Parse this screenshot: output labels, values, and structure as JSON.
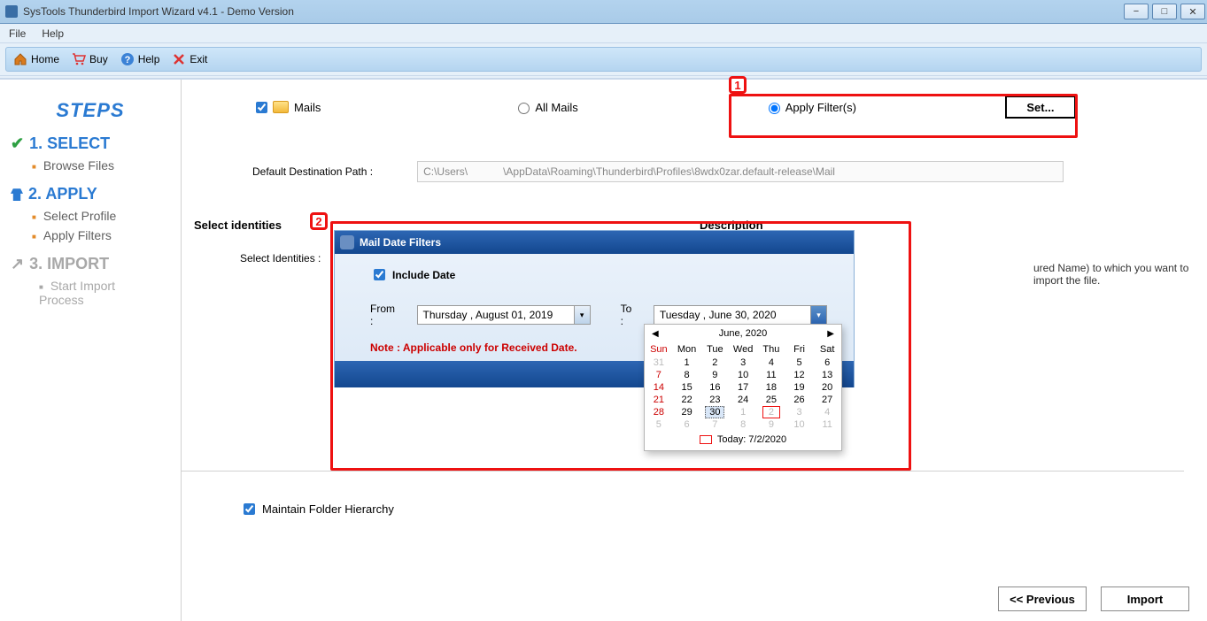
{
  "window": {
    "title": "SysTools Thunderbird Import Wizard v4.1 - Demo Version"
  },
  "menubar": {
    "file": "File",
    "help": "Help"
  },
  "toolbar": {
    "home": "Home",
    "buy": "Buy",
    "help": "Help",
    "exit": "Exit"
  },
  "sidebar": {
    "header": "STEPS",
    "step1": "1. SELECT",
    "s1a": "Browse Files",
    "step2": "2. APPLY",
    "s2a": "Select Profile",
    "s2b": "Apply Filters",
    "step3": "3. IMPORT",
    "s3a": "Start Import Process"
  },
  "content": {
    "mails_label": "Mails",
    "all_mails": "All Mails",
    "apply_filters": "Apply Filter(s)",
    "set_btn": "Set...",
    "dest_label": "Default Destination Path :",
    "dest_value": "C:\\Users\\            \\AppData\\Roaming\\Thunderbird\\Profiles\\8wdx0zar.default-release\\Mail",
    "select_identities_h": "Select identities",
    "description_h": "Description",
    "select_identities_l": "Select Identities :",
    "desc_tail": "ured Name) to  which  you want to import the file.",
    "maintain": "Maintain Folder Hierarchy",
    "prev_btn": "<< Previous",
    "import_btn": "Import"
  },
  "badges": {
    "one": "1",
    "two": "2"
  },
  "dialog": {
    "title": "Mail Date Filters",
    "include": "Include Date",
    "from_l": "From :",
    "from_v": "Thursday  ,    August   01, 2019",
    "to_l": "To :",
    "to_v": "Tuesday   ,       June     30, 2020",
    "note": "Note : Applicable only for Received Date."
  },
  "calendar": {
    "month": "June, 2020",
    "today_label": "Today: 7/2/2020",
    "dow": [
      "Sun",
      "Mon",
      "Tue",
      "Wed",
      "Thu",
      "Fri",
      "Sat"
    ],
    "weeks": [
      [
        {
          "d": "31",
          "o": true
        },
        {
          "d": "1"
        },
        {
          "d": "2"
        },
        {
          "d": "3"
        },
        {
          "d": "4"
        },
        {
          "d": "5"
        },
        {
          "d": "6"
        }
      ],
      [
        {
          "d": "7"
        },
        {
          "d": "8"
        },
        {
          "d": "9"
        },
        {
          "d": "10"
        },
        {
          "d": "11"
        },
        {
          "d": "12"
        },
        {
          "d": "13"
        }
      ],
      [
        {
          "d": "14"
        },
        {
          "d": "15"
        },
        {
          "d": "16"
        },
        {
          "d": "17"
        },
        {
          "d": "18"
        },
        {
          "d": "19"
        },
        {
          "d": "20"
        }
      ],
      [
        {
          "d": "21"
        },
        {
          "d": "22"
        },
        {
          "d": "23"
        },
        {
          "d": "24"
        },
        {
          "d": "25"
        },
        {
          "d": "26"
        },
        {
          "d": "27"
        }
      ],
      [
        {
          "d": "28"
        },
        {
          "d": "29"
        },
        {
          "d": "30",
          "sel": true
        },
        {
          "d": "1",
          "o": true
        },
        {
          "d": "2",
          "o": true,
          "today": true
        },
        {
          "d": "3",
          "o": true
        },
        {
          "d": "4",
          "o": true
        }
      ],
      [
        {
          "d": "5",
          "o": true
        },
        {
          "d": "6",
          "o": true
        },
        {
          "d": "7",
          "o": true
        },
        {
          "d": "8",
          "o": true
        },
        {
          "d": "9",
          "o": true
        },
        {
          "d": "10",
          "o": true
        },
        {
          "d": "11",
          "o": true
        }
      ]
    ]
  }
}
